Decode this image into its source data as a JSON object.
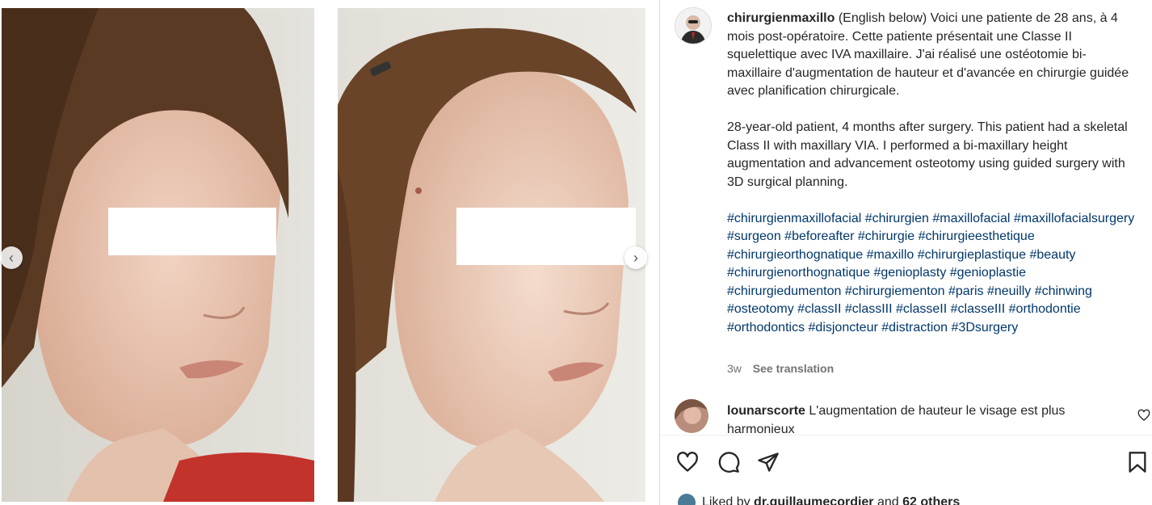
{
  "post": {
    "username": "chirurgienmaxillo",
    "caption_fr": " (English below) Voici une patiente de 28 ans, à 4 mois post-opératoire. Cette patiente présentait une Classe II squelettique avec IVA maxillaire. J'ai réalisé une ostéotomie bi-maxillaire d'augmentation de hauteur et d'avancée en chirurgie guidée avec planification chirurgicale.",
    "caption_en": "28-year-old patient, 4 months after surgery. This patient had a skeletal Class II with maxillary VIA. I performed a bi-maxillary height augmentation and advancement osteotomy using guided surgery with 3D surgical planning.",
    "hashtags": [
      "#chirurgienmaxillofacial",
      "#chirurgien",
      "#maxillofacial",
      "#maxillofacialsurgery",
      "#surgeon",
      "#beforeafter",
      "#chirurgie",
      "#chirurgieesthetique",
      "#chirurgieorthognatique",
      "#maxillo",
      "#chirurgieplastique",
      "#beauty",
      "#chirurgienorthognatique",
      "#genioplasty",
      "#genioplastie",
      "#chirurgiedumenton",
      "#chirurgiementon",
      "#paris",
      "#neuilly",
      "#chinwing",
      "#osteotomy",
      "#classII",
      "#classIII",
      "#classeII",
      "#classeIII",
      "#orthodontie",
      "#orthodontics",
      "#disjoncteur",
      "#distraction",
      "#3Dsurgery"
    ],
    "age": "3w",
    "see_translation": "See translation"
  },
  "comment": {
    "username": "lounarscorte",
    "text": " L'augmentation de hauteur le visage est plus harmonieux"
  },
  "likes": {
    "prefix": "Liked by ",
    "user": "dr.guillaumecordier",
    "middle": " and ",
    "others": "62 others"
  },
  "icons": {
    "prev": "chevron-left-icon",
    "next": "chevron-right-icon",
    "like": "heart-icon",
    "comment": "comment-bubble-icon",
    "share": "paper-plane-icon",
    "save": "bookmark-icon"
  },
  "colors": {
    "hashtag": "#00376b",
    "text": "#262626",
    "secondary": "#737373",
    "divider": "#dbdbdb"
  }
}
